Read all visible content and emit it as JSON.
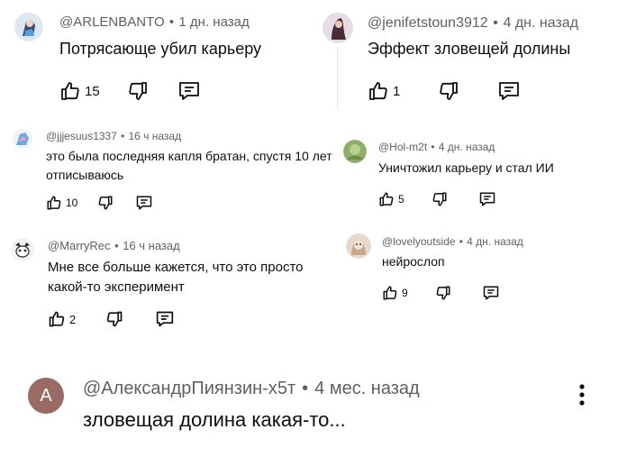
{
  "comments": [
    {
      "author": "@ARLENBANTO",
      "time": "1 дн. назад",
      "text": "Потрясающе убил карьеру",
      "likes": "15"
    },
    {
      "author": "@jenifetstoun3912",
      "time": "4 дн. назад",
      "text": "Эффект зловещей долины",
      "likes": "1"
    },
    {
      "author": "@jjjesuus1337",
      "time": "16 ч назад",
      "text": "это была последняя капля братан, спустя 10 лет отписываюсь",
      "likes": "10"
    },
    {
      "author": "@Hol-m2t",
      "time": "4 дн. назад",
      "text": "Уничтожил карьеру и стал ИИ",
      "likes": "5"
    },
    {
      "author": "@MarryRec",
      "time": "16 ч назад",
      "text": "Мне все больше кажется, что это просто какой-то эксперимент",
      "likes": "2"
    },
    {
      "author": "@lovelyoutside",
      "time": "4 дн. назад",
      "text": "нейрослоп",
      "likes": "9"
    },
    {
      "author": "@АлександрПиянзин-x5т",
      "time": "4 мес. назад",
      "text": "зловещая долина какая-то...",
      "avatar_letter": "А"
    }
  ],
  "separator": "•",
  "colors": {
    "avatar_a": "#9a6a64",
    "meta": "#606060",
    "text": "#0f0f0f"
  }
}
